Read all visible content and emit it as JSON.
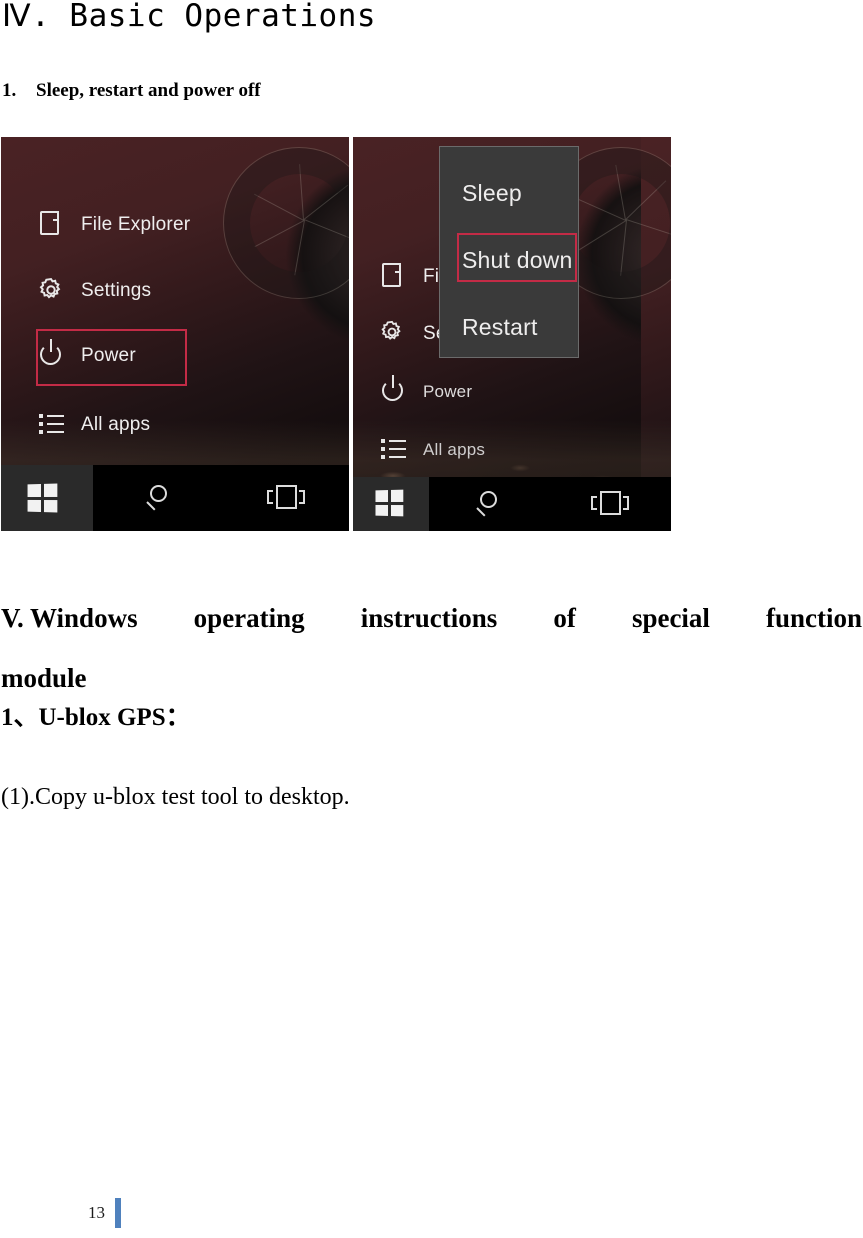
{
  "document": {
    "title": "Ⅳ. Basic Operations",
    "heading_number": "1.",
    "heading_text": "Sleep, restart and power off",
    "section_title_words": [
      "V. Windows",
      "operating",
      "instructions",
      "of",
      "special",
      "function"
    ],
    "section_title_line2": "module",
    "subsection": "1、U-blox  GPS：",
    "body_line": "(1).Copy u-blox test tool to desktop.",
    "page_number": "13",
    "page_bar_color": "#4f81bd"
  },
  "figures": {
    "left_screenshot": {
      "name": "windows-start-menu-power-highlighted",
      "menu_items": [
        {
          "label": "File Explorer",
          "icon": "file-explorer-icon"
        },
        {
          "label": "Settings",
          "icon": "settings-gear-icon"
        },
        {
          "label": "Power",
          "icon": "power-icon",
          "highlighted": true
        },
        {
          "label": "All apps",
          "icon": "all-apps-list-icon"
        }
      ],
      "taskbar": [
        {
          "name": "start-button",
          "icon": "windows-logo-icon"
        },
        {
          "name": "search-button",
          "icon": "search-icon"
        },
        {
          "name": "task-view-button",
          "icon": "task-view-icon"
        }
      ],
      "highlight_color": "#c32b46"
    },
    "right_screenshot": {
      "name": "windows-power-context-menu-shutdown-highlighted",
      "context_menu_items": [
        {
          "label": "Sleep",
          "highlighted": false
        },
        {
          "label": "Shut down",
          "highlighted": true
        },
        {
          "label": "Restart",
          "highlighted": false
        }
      ],
      "menu_items": [
        {
          "label": "Fil",
          "icon": "file-explorer-icon"
        },
        {
          "label": "Se",
          "icon": "settings-gear-icon"
        },
        {
          "label": "Power",
          "icon": "power-icon"
        },
        {
          "label": "All apps",
          "icon": "all-apps-list-icon"
        }
      ],
      "taskbar": [
        {
          "name": "start-button",
          "icon": "windows-logo-icon"
        },
        {
          "name": "search-button",
          "icon": "search-icon"
        },
        {
          "name": "task-view-button",
          "icon": "task-view-icon"
        }
      ],
      "highlight_color": "#c32b46"
    }
  }
}
